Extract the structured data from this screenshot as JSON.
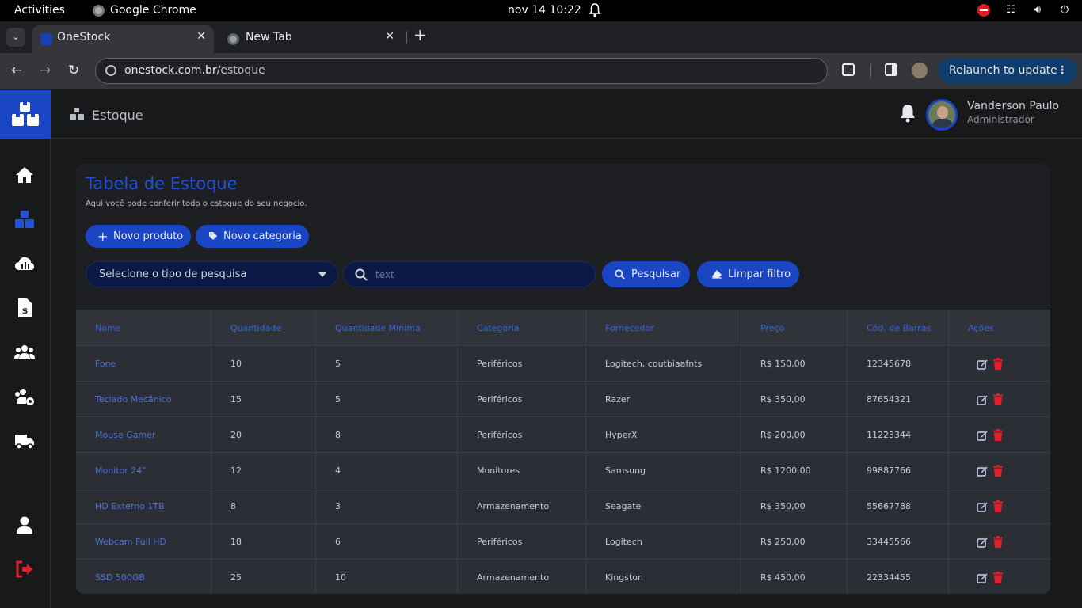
{
  "os": {
    "activities": "Activities",
    "app_name": "Google Chrome",
    "clock": "nov 14  10:22"
  },
  "browser": {
    "tabs": [
      {
        "label": "OneStock",
        "active": true
      },
      {
        "label": "New Tab",
        "active": false
      }
    ],
    "url_host": "onestock.com.br",
    "url_path": "/estoque",
    "relaunch_label": "Relaunch to update"
  },
  "header": {
    "breadcrumb": "Estoque",
    "user_name": "Vanderson Paulo",
    "user_role": "Administrador"
  },
  "page": {
    "title": "Tabela de Estoque",
    "subtitle": "Aqui você pode conferir todo o estoque do seu negocio.",
    "new_product_label": "Novo produto",
    "new_category_label": "Novo categoria",
    "search_type_placeholder": "Selecione o tipo de pesquisa",
    "search_placeholder": "text",
    "search_button_label": "Pesquisar",
    "clear_filter_label": "Limpar filtro"
  },
  "table": {
    "columns": [
      "Nome",
      "Quantidade",
      "Quantidade Minima",
      "Categoria",
      "Fornecedor",
      "Preço",
      "Cód. de Barras",
      "Ações"
    ],
    "rows": [
      [
        "Fone",
        "10",
        "5",
        "Periféricos",
        "Logitech, coutbiaafnts",
        "R$ 150,00",
        "12345678"
      ],
      [
        "Teclado Mecânico",
        "15",
        "5",
        "Periféricos",
        "Razer",
        "R$ 350,00",
        "87654321"
      ],
      [
        "Mouse Gamer",
        "20",
        "8",
        "Periféricos",
        "HyperX",
        "R$ 200,00",
        "11223344"
      ],
      [
        "Monitor 24\"",
        "12",
        "4",
        "Monitores",
        "Samsung",
        "R$ 1200,00",
        "99887766"
      ],
      [
        "HD Externo 1TB",
        "8",
        "3",
        "Armazenamento",
        "Seagate",
        "R$ 350,00",
        "55667788"
      ],
      [
        "Webcam Full HD",
        "18",
        "6",
        "Periféricos",
        "Logitech",
        "R$ 250,00",
        "33445566"
      ],
      [
        "SSD 500GB",
        "25",
        "10",
        "Armazenamento",
        "Kingston",
        "R$ 450,00",
        "22334455"
      ]
    ]
  },
  "colors": {
    "accent": "#1a46c4",
    "danger": "#e0212b",
    "logout": "#e0212b"
  }
}
